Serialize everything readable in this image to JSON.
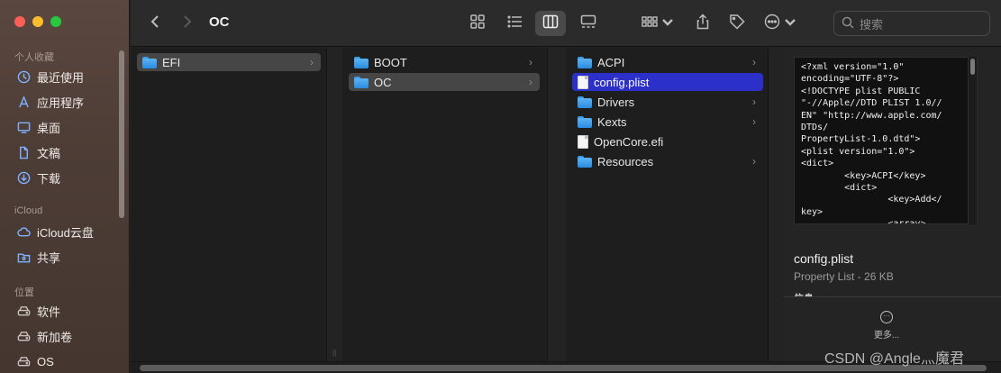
{
  "sidebar": {
    "sections": [
      {
        "label": "个人收藏"
      },
      {
        "label": "iCloud"
      },
      {
        "label": "位置"
      }
    ],
    "favorites": [
      {
        "label": "最近使用",
        "icon": "clock-icon"
      },
      {
        "label": "应用程序",
        "icon": "apps-icon"
      },
      {
        "label": "桌面",
        "icon": "desktop-icon"
      },
      {
        "label": "文稿",
        "icon": "document-icon"
      },
      {
        "label": "下载",
        "icon": "download-icon"
      }
    ],
    "icloud": [
      {
        "label": "iCloud云盘",
        "icon": "cloud-icon"
      },
      {
        "label": "共享",
        "icon": "shared-folder-icon"
      }
    ],
    "locations": [
      {
        "label": "软件",
        "icon": "disk-icon"
      },
      {
        "label": "新加卷",
        "icon": "disk-icon"
      },
      {
        "label": "OS",
        "icon": "disk-icon"
      }
    ]
  },
  "toolbar": {
    "title": "OC",
    "search_placeholder": "搜索"
  },
  "columns": [
    {
      "items": [
        {
          "name": "EFI",
          "type": "folder",
          "state": "selected-inactive",
          "has_children": true
        }
      ]
    },
    {
      "items": [
        {
          "name": "BOOT",
          "type": "folder",
          "state": "normal",
          "has_children": true
        },
        {
          "name": "OC",
          "type": "folder",
          "state": "selected-inactive",
          "has_children": true
        }
      ]
    },
    {
      "items": [
        {
          "name": "ACPI",
          "type": "folder",
          "state": "normal",
          "has_children": true
        },
        {
          "name": "config.plist",
          "type": "file",
          "state": "selected-active",
          "has_children": false
        },
        {
          "name": "Drivers",
          "type": "folder",
          "state": "normal",
          "has_children": true
        },
        {
          "name": "Kexts",
          "type": "folder",
          "state": "normal",
          "has_children": true
        },
        {
          "name": "OpenCore.efi",
          "type": "file",
          "state": "normal",
          "has_children": false
        },
        {
          "name": "Resources",
          "type": "folder",
          "state": "normal",
          "has_children": true
        }
      ]
    }
  ],
  "preview": {
    "code": "<?xml version=\"1.0\"\nencoding=\"UTF-8\"?>\n<!DOCTYPE plist PUBLIC\n\"-//Apple//DTD PLIST 1.0//\nEN\" \"http://www.apple.com/\nDTDs/\nPropertyList-1.0.dtd\">\n<plist version=\"1.0\">\n<dict>\n        <key>ACPI</key>\n        <dict>\n                <key>Add</\nkey>\n                <array>",
    "file_name": "config.plist",
    "file_kind": "Property List - 26 KB",
    "info_label": "信息",
    "more_label": "更多..."
  },
  "watermark": "CSDN @Angle灬魔君",
  "colors": {
    "selection_active": "#2d2fc9",
    "selection_inactive": "#464646",
    "folder": "#3e9be8"
  }
}
